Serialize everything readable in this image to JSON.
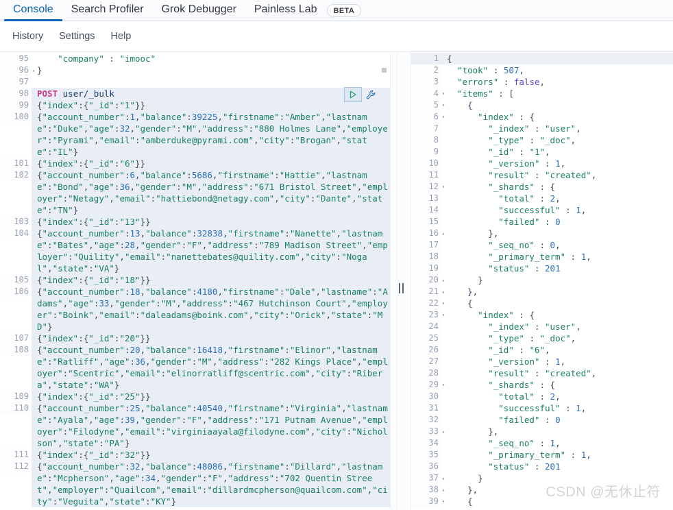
{
  "app": {
    "name": "Kibana Dev Tools Console",
    "accent_color": "#0b64b8",
    "highlight_color": "#e9eef6",
    "watermark": "CSDN @无休止符"
  },
  "tabs": [
    {
      "label": "Console",
      "active": true
    },
    {
      "label": "Search Profiler",
      "active": false
    },
    {
      "label": "Grok Debugger",
      "active": false
    },
    {
      "label": "Painless Lab",
      "active": false
    }
  ],
  "beta_badge": "BETA",
  "subnav": [
    {
      "label": "History"
    },
    {
      "label": "Settings"
    },
    {
      "label": "Help"
    }
  ],
  "actions": {
    "play_icon": "play-triangle-icon",
    "wrench_icon": "wrench-icon"
  },
  "request_editor": {
    "name": "console-request-editor",
    "first_visible_line": 95,
    "lines": [
      {
        "no": 95,
        "clipped": true,
        "hl": false,
        "fold": "",
        "text": "    \"company\" : \"imooc\""
      },
      {
        "no": 96,
        "hl": false,
        "fold": "up",
        "text": "}"
      },
      {
        "no": 97,
        "hl": false,
        "fold": "",
        "text": ""
      },
      {
        "no": 98,
        "hl": true,
        "fold": "",
        "text": "POST user/_bulk",
        "kind": "request-line",
        "method": "POST",
        "url": "user/_bulk"
      },
      {
        "no": 99,
        "hl": true,
        "fold": "",
        "text": "{\"index\":{\"_id\":\"1\"}}"
      },
      {
        "no": 100,
        "hl": true,
        "fold": "",
        "text": "{\"account_number\":1,\"balance\":39225,\"firstname\":\"Amber\",\"lastname\":\"Duke\",\"age\":32,\"gender\":\"M\",\"address\":\"880 Holmes Lane\",\"employer\":\"Pyrami\",\"email\":\"amberduke@pyrami.com\",\"city\":\"Brogan\",\"state\":\"IL\"}"
      },
      {
        "no": 101,
        "hl": true,
        "fold": "",
        "text": "{\"index\":{\"_id\":\"6\"}}"
      },
      {
        "no": 102,
        "hl": true,
        "fold": "",
        "text": "{\"account_number\":6,\"balance\":5686,\"firstname\":\"Hattie\",\"lastname\":\"Bond\",\"age\":36,\"gender\":\"M\",\"address\":\"671 Bristol Street\",\"employer\":\"Netagy\",\"email\":\"hattiebond@netagy.com\",\"city\":\"Dante\",\"state\":\"TN\"}"
      },
      {
        "no": 103,
        "hl": true,
        "fold": "",
        "text": "{\"index\":{\"_id\":\"13\"}}"
      },
      {
        "no": 104,
        "hl": true,
        "fold": "",
        "text": "{\"account_number\":13,\"balance\":32838,\"firstname\":\"Nanette\",\"lastname\":\"Bates\",\"age\":28,\"gender\":\"F\",\"address\":\"789 Madison Street\",\"employer\":\"Quility\",\"email\":\"nanettebates@quility.com\",\"city\":\"Nogal\",\"state\":\"VA\"}"
      },
      {
        "no": 105,
        "hl": true,
        "fold": "",
        "text": "{\"index\":{\"_id\":\"18\"}}"
      },
      {
        "no": 106,
        "hl": true,
        "fold": "",
        "text": "{\"account_number\":18,\"balance\":4180,\"firstname\":\"Dale\",\"lastname\":\"Adams\",\"age\":33,\"gender\":\"M\",\"address\":\"467 Hutchinson Court\",\"employer\":\"Boink\",\"email\":\"daleadams@boink.com\",\"city\":\"Orick\",\"state\":\"MD\"}"
      },
      {
        "no": 107,
        "hl": true,
        "fold": "",
        "text": "{\"index\":{\"_id\":\"20\"}}"
      },
      {
        "no": 108,
        "hl": true,
        "fold": "",
        "text": "{\"account_number\":20,\"balance\":16418,\"firstname\":\"Elinor\",\"lastname\":\"Ratliff\",\"age\":36,\"gender\":\"M\",\"address\":\"282 Kings Place\",\"employer\":\"Scentric\",\"email\":\"elinorratliff@scentric.com\",\"city\":\"Ribera\",\"state\":\"WA\"}"
      },
      {
        "no": 109,
        "hl": true,
        "fold": "",
        "text": "{\"index\":{\"_id\":\"25\"}}"
      },
      {
        "no": 110,
        "hl": true,
        "fold": "",
        "text": "{\"account_number\":25,\"balance\":40540,\"firstname\":\"Virginia\",\"lastname\":\"Ayala\",\"age\":39,\"gender\":\"F\",\"address\":\"171 Putnam Avenue\",\"employer\":\"Filodyne\",\"email\":\"virginiaayala@filodyne.com\",\"city\":\"Nicholson\",\"state\":\"PA\"}"
      },
      {
        "no": 111,
        "hl": true,
        "fold": "",
        "text": "{\"index\":{\"_id\":\"32\"}}"
      },
      {
        "no": 112,
        "hl": true,
        "fold": "",
        "text": "{\"account_number\":32,\"balance\":48086,\"firstname\":\"Dillard\",\"lastname\":\"Mcpherson\",\"age\":34,\"gender\":\"F\",\"address\":\"702 Quentin Street\",\"employer\":\"Quailcom\",\"email\":\"dillardmcpherson@quailcom.com\",\"city\":\"Veguita\",\"state\":\"KY\"}"
      }
    ]
  },
  "response_editor": {
    "name": "console-response-viewer",
    "lines": [
      {
        "no": 1,
        "fold": "down",
        "indent": 0,
        "cur": true,
        "text": "{"
      },
      {
        "no": 2,
        "fold": "",
        "indent": 1,
        "text": "\"took\" : 507,"
      },
      {
        "no": 3,
        "fold": "",
        "indent": 1,
        "text": "\"errors\" : false,"
      },
      {
        "no": 4,
        "fold": "down",
        "indent": 1,
        "text": "\"items\" : ["
      },
      {
        "no": 5,
        "fold": "down",
        "indent": 2,
        "text": "{"
      },
      {
        "no": 6,
        "fold": "down",
        "indent": 3,
        "text": "\"index\" : {"
      },
      {
        "no": 7,
        "fold": "",
        "indent": 4,
        "text": "\"_index\" : \"user\","
      },
      {
        "no": 8,
        "fold": "",
        "indent": 4,
        "text": "\"_type\" : \"_doc\","
      },
      {
        "no": 9,
        "fold": "",
        "indent": 4,
        "text": "\"_id\" : \"1\","
      },
      {
        "no": 10,
        "fold": "",
        "indent": 4,
        "text": "\"_version\" : 1,"
      },
      {
        "no": 11,
        "fold": "",
        "indent": 4,
        "text": "\"result\" : \"created\","
      },
      {
        "no": 12,
        "fold": "down",
        "indent": 4,
        "text": "\"_shards\" : {"
      },
      {
        "no": 13,
        "fold": "",
        "indent": 5,
        "text": "\"total\" : 2,"
      },
      {
        "no": 14,
        "fold": "",
        "indent": 5,
        "text": "\"successful\" : 1,"
      },
      {
        "no": 15,
        "fold": "",
        "indent": 5,
        "text": "\"failed\" : 0"
      },
      {
        "no": 16,
        "fold": "up",
        "indent": 4,
        "text": "},"
      },
      {
        "no": 17,
        "fold": "",
        "indent": 4,
        "text": "\"_seq_no\" : 0,"
      },
      {
        "no": 18,
        "fold": "",
        "indent": 4,
        "text": "\"_primary_term\" : 1,"
      },
      {
        "no": 19,
        "fold": "",
        "indent": 4,
        "text": "\"status\" : 201"
      },
      {
        "no": 20,
        "fold": "up",
        "indent": 3,
        "text": "}"
      },
      {
        "no": 21,
        "fold": "up",
        "indent": 2,
        "text": "},"
      },
      {
        "no": 22,
        "fold": "down",
        "indent": 2,
        "text": "{"
      },
      {
        "no": 23,
        "fold": "down",
        "indent": 3,
        "text": "\"index\" : {"
      },
      {
        "no": 24,
        "fold": "",
        "indent": 4,
        "text": "\"_index\" : \"user\","
      },
      {
        "no": 25,
        "fold": "",
        "indent": 4,
        "text": "\"_type\" : \"_doc\","
      },
      {
        "no": 26,
        "fold": "",
        "indent": 4,
        "text": "\"_id\" : \"6\","
      },
      {
        "no": 27,
        "fold": "",
        "indent": 4,
        "text": "\"_version\" : 1,"
      },
      {
        "no": 28,
        "fold": "",
        "indent": 4,
        "text": "\"result\" : \"created\","
      },
      {
        "no": 29,
        "fold": "down",
        "indent": 4,
        "text": "\"_shards\" : {"
      },
      {
        "no": 30,
        "fold": "",
        "indent": 5,
        "text": "\"total\" : 2,"
      },
      {
        "no": 31,
        "fold": "",
        "indent": 5,
        "text": "\"successful\" : 1,"
      },
      {
        "no": 32,
        "fold": "",
        "indent": 5,
        "text": "\"failed\" : 0"
      },
      {
        "no": 33,
        "fold": "up",
        "indent": 4,
        "text": "},"
      },
      {
        "no": 34,
        "fold": "",
        "indent": 4,
        "text": "\"_seq_no\" : 1,"
      },
      {
        "no": 35,
        "fold": "",
        "indent": 4,
        "text": "\"_primary_term\" : 1,"
      },
      {
        "no": 36,
        "fold": "",
        "indent": 4,
        "text": "\"status\" : 201"
      },
      {
        "no": 37,
        "fold": "up",
        "indent": 3,
        "text": "}"
      },
      {
        "no": 38,
        "fold": "up",
        "indent": 2,
        "text": "},"
      },
      {
        "no": 39,
        "fold": "down",
        "indent": 2,
        "text": "{"
      }
    ]
  }
}
